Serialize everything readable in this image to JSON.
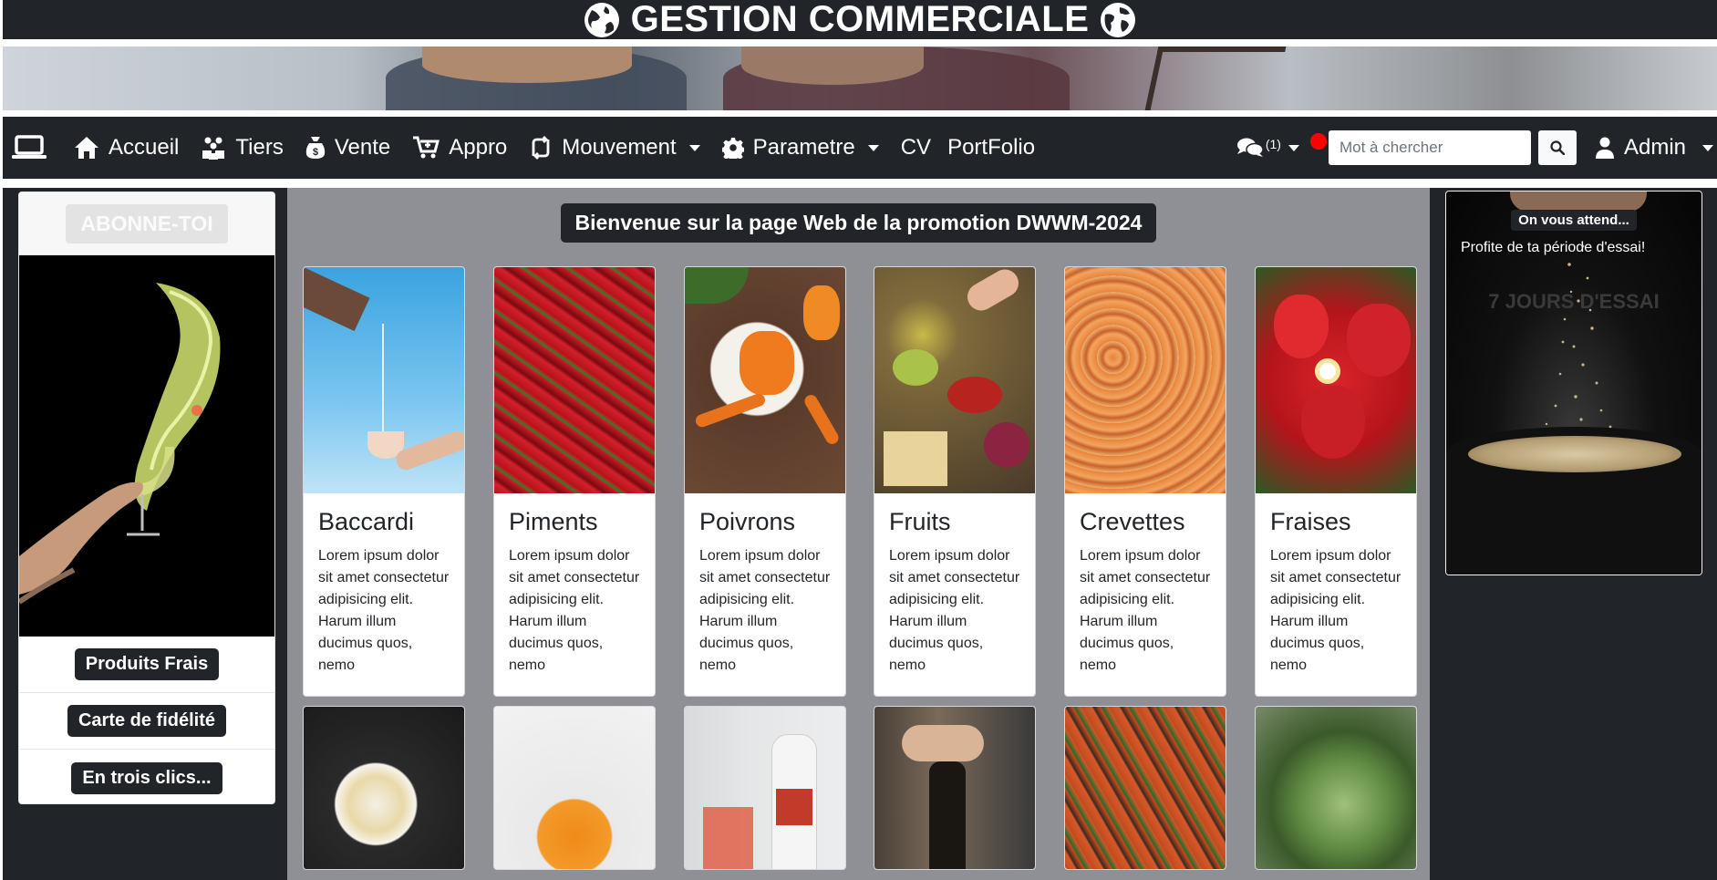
{
  "header": {
    "title": "GESTION COMMERCIALE"
  },
  "nav": {
    "items": [
      {
        "label": "Accueil"
      },
      {
        "label": "Tiers"
      },
      {
        "label": "Vente"
      },
      {
        "label": "Appro"
      },
      {
        "label": "Mouvement"
      },
      {
        "label": "Parametre"
      },
      {
        "label": "CV"
      },
      {
        "label": "PortFolio"
      }
    ],
    "messages_count": "(1)",
    "search_placeholder": "Mot à chercher",
    "user": "Admin"
  },
  "left_panel": {
    "subscribe": "ABONNE-TOI",
    "buttons": [
      "Produits Frais",
      "Carte de fidélité",
      "En trois clics..."
    ]
  },
  "main": {
    "welcome": "Bienvenue sur la page Web de la promotion DWWM-2024",
    "products": [
      {
        "title": "Baccardi",
        "text": "Lorem ipsum dolor sit amet consectetur adipisicing elit. Harum illum ducimus quos, nemo"
      },
      {
        "title": "Piments",
        "text": "Lorem ipsum dolor sit amet consectetur adipisicing elit. Harum illum ducimus quos, nemo"
      },
      {
        "title": "Poivrons",
        "text": "Lorem ipsum dolor sit amet consectetur adipisicing elit. Harum illum ducimus quos, nemo"
      },
      {
        "title": "Fruits",
        "text": "Lorem ipsum dolor sit amet consectetur adipisicing elit. Harum illum ducimus quos, nemo"
      },
      {
        "title": "Crevettes",
        "text": "Lorem ipsum dolor sit amet consectetur adipisicing elit. Harum illum ducimus quos, nemo"
      },
      {
        "title": "Fraises",
        "text": "Lorem ipsum dolor sit amet consectetur adipisicing elit. Harum illum ducimus quos, nemo"
      }
    ]
  },
  "right_panel": {
    "badge": "On vous attend...",
    "text": "Profite de ta période d'essai!",
    "trial": "7 JOURS D'ESSAI"
  },
  "colors": {
    "dark": "#212529",
    "center_bg": "#8e9095",
    "alert": "#ff0000"
  }
}
